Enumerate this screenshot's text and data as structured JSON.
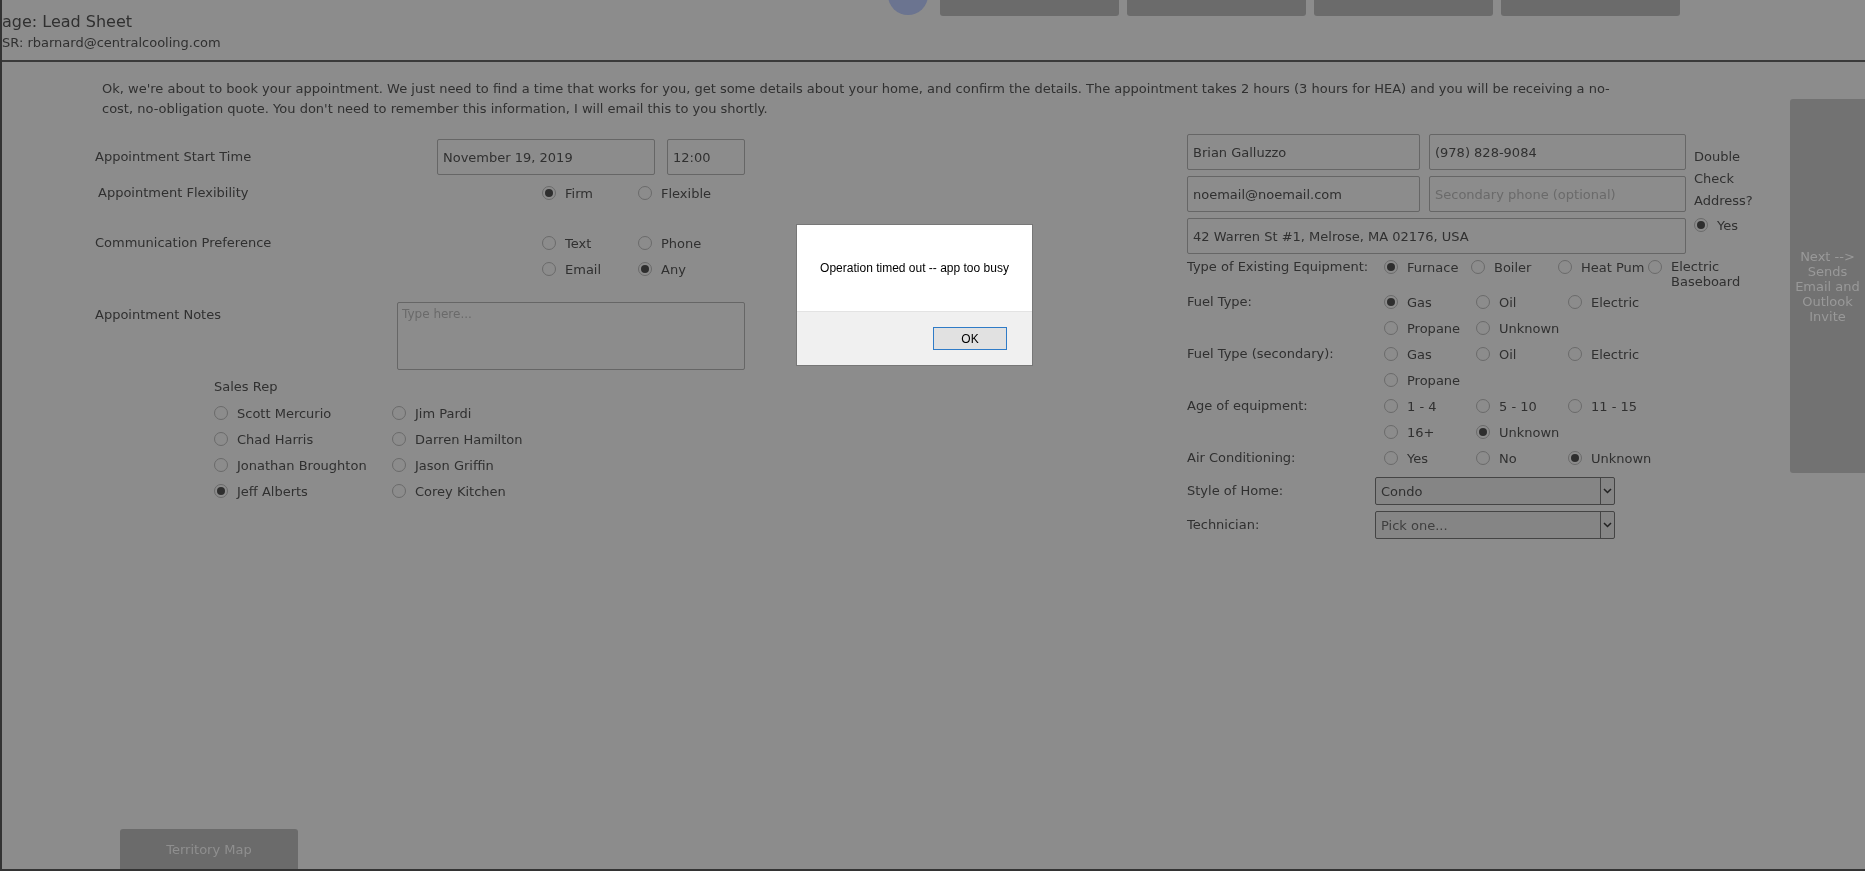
{
  "header": {
    "page_label": "age: Lead Sheet",
    "csr_label": "SR: rbarnard@centralcooling.com"
  },
  "intro": "Ok, we're about to book your appointment. We just need to find a time that works for you, get some details about your home, and confirm the details. The appointment takes 2 hours (3 hours for HEA) and you will be receiving a no-cost, no-obligation quote. You don't need to remember this information, I will email this to you shortly.",
  "appointment": {
    "start_label": "Appointment Start Time",
    "date": "November 19, 2019",
    "time": "12:00",
    "flexibility": {
      "label": "Appointment Flexibility",
      "options": [
        {
          "label": "Firm",
          "selected": true
        },
        {
          "label": "Flexible",
          "selected": false
        }
      ]
    },
    "communication": {
      "label": "Communication Preference",
      "options": [
        {
          "label": "Text",
          "selected": false
        },
        {
          "label": "Phone",
          "selected": false
        },
        {
          "label": "Email",
          "selected": false
        },
        {
          "label": "Any",
          "selected": true
        }
      ]
    },
    "notes": {
      "label": "Appointment Notes",
      "placeholder": "Type here..."
    }
  },
  "sales_rep": {
    "label": "Sales Rep",
    "options": [
      {
        "label": "Scott Mercurio",
        "selected": false
      },
      {
        "label": "Jim Pardi",
        "selected": false
      },
      {
        "label": "Chad Harris",
        "selected": false
      },
      {
        "label": "Darren Hamilton",
        "selected": false
      },
      {
        "label": "Jonathan Broughton",
        "selected": false
      },
      {
        "label": "Jason Griffin",
        "selected": false
      },
      {
        "label": "Jeff Alberts",
        "selected": true
      },
      {
        "label": "Corey Kitchen",
        "selected": false
      }
    ]
  },
  "contact": {
    "name": "Brian Galluzzo",
    "phone": "(978) 828-9084",
    "email": "noemail@noemail.com",
    "secondary_phone_placeholder": "Secondary phone (optional)",
    "address": "42 Warren St #1, Melrose, MA 02176, USA",
    "double_check_label": "Double Check Address?",
    "double_check": {
      "label": "Yes",
      "selected": true
    }
  },
  "equipment_groups": [
    {
      "label": "Type of Existing Equipment:",
      "options": [
        {
          "label": "Furnace",
          "selected": true
        },
        {
          "label": "Boiler",
          "selected": false
        },
        {
          "label": "Heat Pum",
          "selected": false
        },
        {
          "label": "Electric Baseboard",
          "selected": false
        }
      ]
    },
    {
      "label": "Fuel Type:",
      "options": [
        {
          "label": "Gas",
          "selected": true
        },
        {
          "label": "Oil",
          "selected": false
        },
        {
          "label": "Electric",
          "selected": false
        },
        {
          "label": "Propane",
          "selected": false
        },
        {
          "label": "Unknown",
          "selected": false
        }
      ]
    },
    {
      "label": "Fuel Type (secondary):",
      "options": [
        {
          "label": "Gas",
          "selected": false
        },
        {
          "label": "Oil",
          "selected": false
        },
        {
          "label": "Electric",
          "selected": false
        },
        {
          "label": "Propane",
          "selected": false
        }
      ]
    },
    {
      "label": "Age of equipment:",
      "options": [
        {
          "label": "1 - 4",
          "selected": false
        },
        {
          "label": "5 - 10",
          "selected": false
        },
        {
          "label": "11 - 15",
          "selected": false
        },
        {
          "label": "16+",
          "selected": false
        },
        {
          "label": "Unknown",
          "selected": true
        }
      ]
    },
    {
      "label": "Air Conditioning:",
      "options": [
        {
          "label": "Yes",
          "selected": false
        },
        {
          "label": "No",
          "selected": false
        },
        {
          "label": "Unknown",
          "selected": true
        }
      ]
    }
  ],
  "selects": [
    {
      "label": "Style of Home:",
      "value": "Condo"
    },
    {
      "label": "Technician:",
      "placeholder": "Pick one..."
    }
  ],
  "next_button": "Next --> Sends Email and Outlook Invite",
  "territory_button": "Territory Map",
  "dialog": {
    "message": "Operation timed out -- app too busy",
    "button": "OK"
  }
}
